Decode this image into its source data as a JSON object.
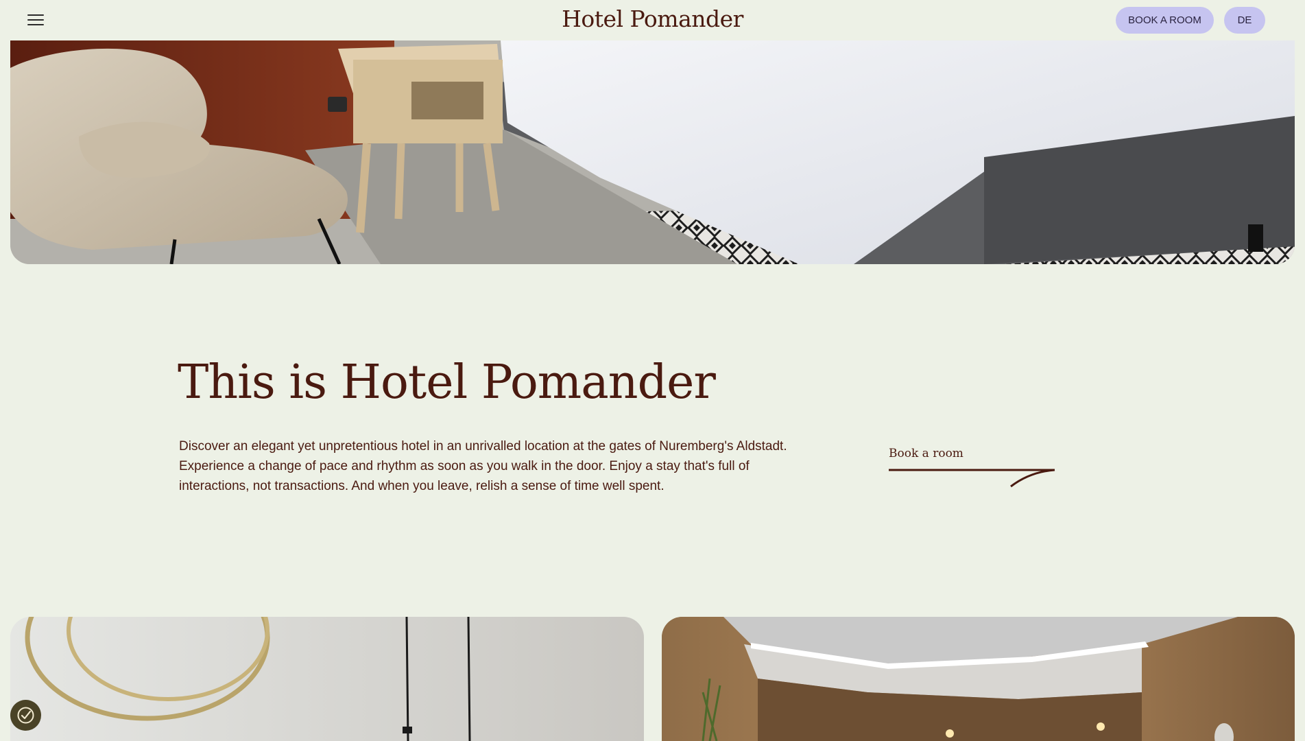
{
  "header": {
    "brand": "Hotel Pomander",
    "book_button": "BOOK A ROOM",
    "language_button": "DE",
    "accent_color": "#c6c4f0"
  },
  "hero": {
    "image": "hotel room with armchair, bedside table and bed on patterned rug"
  },
  "intro": {
    "title": "This is Hotel Pomander",
    "paragraph": "Discover an elegant yet unpretentious hotel in an unrivalled location at the gates of Nuremberg's Aldstadt. Experience a change of pace and rhythm as soon as you walk in the door. Enjoy a stay that's full of interactions, not transactions. And when you leave, relish a sense of time well spent.",
    "cta_label": "Book a room"
  },
  "cards": [
    {
      "image": "white wall with brass ring mirrors and hanging cord"
    },
    {
      "image": "wood-panelled interior with illuminated ceiling"
    }
  ],
  "cookie": {
    "icon": "cookie-consent-icon"
  },
  "colors": {
    "background": "#edf1e6",
    "text": "#4a1a10"
  }
}
